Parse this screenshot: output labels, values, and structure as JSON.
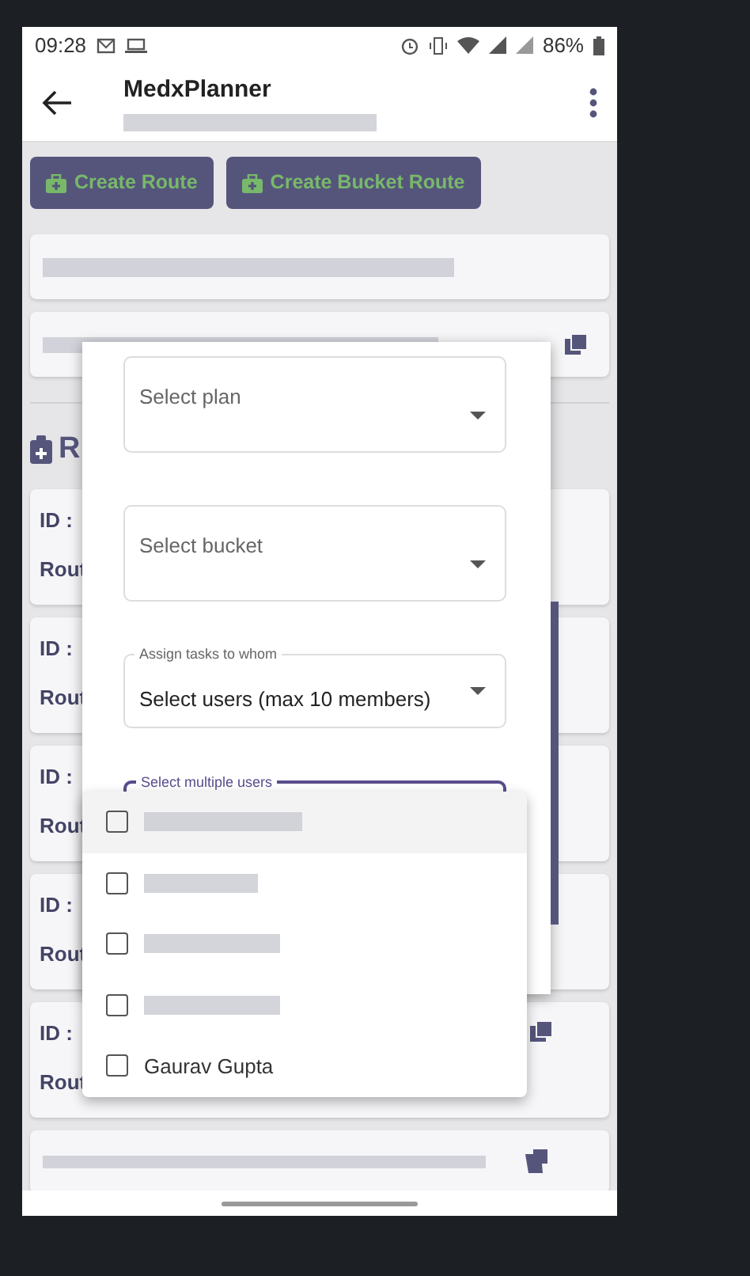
{
  "status_bar": {
    "time": "09:28",
    "battery": "86%"
  },
  "app_bar": {
    "title": "MedxPlanner",
    "subtitle_redacted": true
  },
  "actions": [
    {
      "label": "Create Route"
    },
    {
      "label": "Create Bucket Route"
    }
  ],
  "section_heading": "R",
  "route_cards": [
    {
      "id_label": "ID :",
      "route_label": "Rout",
      "copy_icon": false
    },
    {
      "id_label": "ID :",
      "route_label": "Rout",
      "copy_icon": false
    },
    {
      "id_label": "ID :",
      "route_label": "Rout",
      "copy_icon": false
    },
    {
      "id_label": "ID :",
      "route_label": "Rout",
      "copy_icon": false
    },
    {
      "id_label": "ID :",
      "route_label": "Rout",
      "copy_icon": true
    }
  ],
  "dialog": {
    "fields": [
      {
        "kind": "inline",
        "label": "Select plan",
        "focused": false
      },
      {
        "kind": "inline",
        "label": "Select bucket",
        "focused": false
      },
      {
        "kind": "floating",
        "label": "Assign tasks to whom",
        "value": "Select users (max 10 members)",
        "focused": false
      },
      {
        "kind": "floating",
        "label": "Select multiple users",
        "focused": true
      }
    ],
    "menu": [
      {
        "kind": "redacted",
        "checked": false,
        "highlighted": true
      },
      {
        "kind": "redacted",
        "checked": false,
        "highlighted": false
      },
      {
        "kind": "redacted",
        "checked": false,
        "highlighted": false
      },
      {
        "kind": "redacted",
        "checked": false,
        "highlighted": false
      },
      {
        "kind": "named",
        "label": "Gaurav Gupta",
        "checked": false,
        "highlighted": false
      }
    ]
  }
}
